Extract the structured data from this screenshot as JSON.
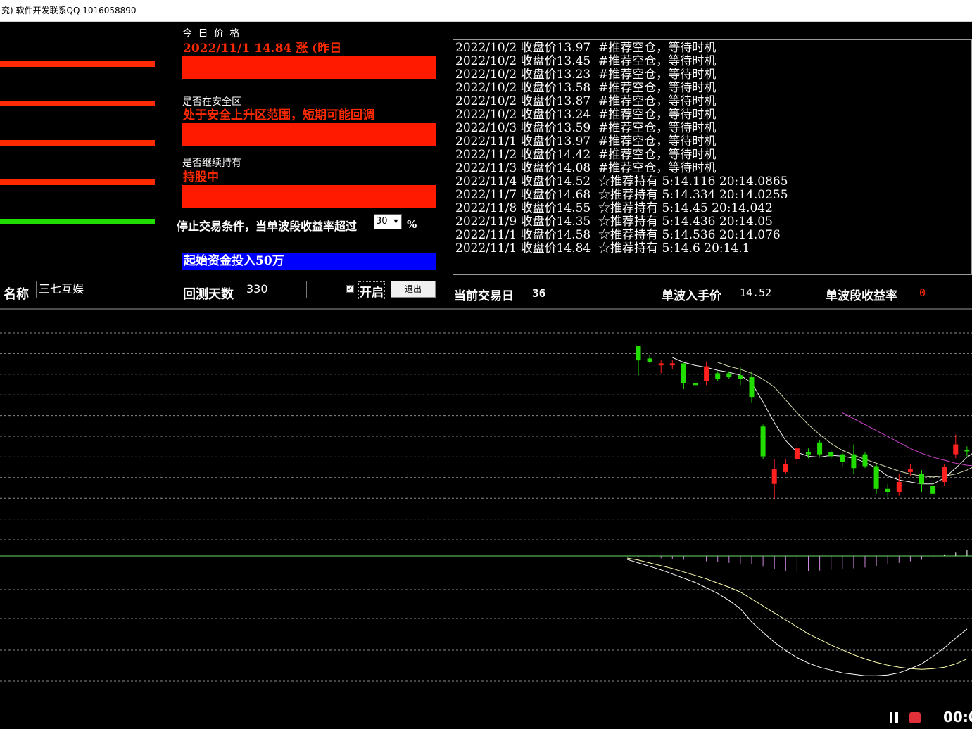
{
  "window": {
    "title": "究) 软件开发联系QQ 1016058890"
  },
  "indicators": [
    {
      "color": "#ff2a00"
    },
    {
      "color": "#ff2a00"
    },
    {
      "color": "#ff2a00"
    },
    {
      "color": "#ff2a00"
    },
    {
      "color": "#22dd00"
    }
  ],
  "today_price": {
    "label": "今 日 价 格",
    "value": "2022/11/1    14.84   涨   (昨日"
  },
  "safe_zone": {
    "label": "是否在安全区",
    "value": "处于安全上升区范围，短期可能回调"
  },
  "hold": {
    "label": "是否继续持有",
    "value": "持股中"
  },
  "stop_condition": {
    "label": "停止交易条件，当单波段收益率超过",
    "selected": "30",
    "unit": "%"
  },
  "capital": {
    "label": "起始资金投入50万"
  },
  "name_field": {
    "label": "名称",
    "value": "三七互娱"
  },
  "backtest": {
    "label": "回测天数",
    "value": "330"
  },
  "start_toggle": {
    "label": "开启",
    "checked": true
  },
  "exit_button": {
    "label": "退出"
  },
  "status": {
    "trade_day_label": "当前交易日",
    "trade_day_value": "36",
    "entry_price_label": "单波入手价",
    "entry_price_value": "14.52",
    "return_label": "单波段收益率",
    "return_value": "0"
  },
  "log": [
    "2022/10/2 收盘价13.97  #推荐空仓，等待时机",
    "2022/10/2 收盘价13.45  #推荐空仓，等待时机",
    "2022/10/2 收盘价13.23  #推荐空仓，等待时机",
    "2022/10/2 收盘价13.58  #推荐空仓，等待时机",
    "2022/10/2 收盘价13.87  #推荐空仓，等待时机",
    "2022/10/2 收盘价13.24  #推荐空仓，等待时机",
    "2022/10/3 收盘价13.59  #推荐空仓，等待时机",
    "2022/11/1 收盘价13.97  #推荐空仓，等待时机",
    "2022/11/2 收盘价14.42  #推荐空仓，等待时机",
    "2022/11/3 收盘价14.08  #推荐空仓，等待时机",
    "2022/11/4 收盘价14.52  ☆推荐持有 5:14.116 20:14.0865",
    "2022/11/7 收盘价14.68  ☆推荐持有 5:14.334 20:14.0255",
    "2022/11/8 收盘价14.55  ☆推荐持有 5:14.45 20:14.042",
    "2022/11/9 收盘价14.35  ☆推荐持有 5:14.436 20:14.05",
    "2022/11/1 收盘价14.58  ☆推荐持有 5:14.536 20:14.076",
    "2022/11/1 收盘价14.84  ☆推荐持有 5:14.6 20:14.1"
  ],
  "recorder": {
    "time": "00:0"
  },
  "colors": {
    "up": "#ff2020",
    "down": "#22dd00",
    "ma5": "#ffffff",
    "ma10": "#ffffcc",
    "ma20": "#cc44cc",
    "zero_line": "#66dd66"
  },
  "chart_data": {
    "type": "candlestick",
    "candles": [
      {
        "o": 13.1,
        "h": 13.1,
        "l": 12.8,
        "c": 12.95
      },
      {
        "o": 12.97,
        "h": 13.0,
        "l": 12.92,
        "c": 12.93
      },
      {
        "o": 12.9,
        "h": 12.95,
        "l": 12.82,
        "c": 12.92
      },
      {
        "o": 12.9,
        "h": 12.95,
        "l": 12.86,
        "c": 12.92
      },
      {
        "o": 12.92,
        "h": 12.92,
        "l": 12.66,
        "c": 12.72
      },
      {
        "o": 12.72,
        "h": 12.74,
        "l": 12.65,
        "c": 12.7
      },
      {
        "o": 12.74,
        "h": 12.94,
        "l": 12.7,
        "c": 12.89
      },
      {
        "o": 12.82,
        "h": 12.84,
        "l": 12.74,
        "c": 12.76
      },
      {
        "o": 12.82,
        "h": 12.84,
        "l": 12.76,
        "c": 12.78
      },
      {
        "o": 12.8,
        "h": 12.88,
        "l": 12.7,
        "c": 12.76
      },
      {
        "o": 12.78,
        "h": 12.84,
        "l": 12.52,
        "c": 12.58
      },
      {
        "o": 12.28,
        "h": 12.3,
        "l": 11.95,
        "c": 11.98
      },
      {
        "o": 11.7,
        "h": 11.95,
        "l": 11.55,
        "c": 11.85
      },
      {
        "o": 11.82,
        "h": 11.95,
        "l": 11.8,
        "c": 11.9
      },
      {
        "o": 11.95,
        "h": 12.12,
        "l": 11.9,
        "c": 12.06
      },
      {
        "o": 12.02,
        "h": 12.06,
        "l": 11.96,
        "c": 12.0
      },
      {
        "o": 12.12,
        "h": 12.14,
        "l": 11.98,
        "c": 12.0
      },
      {
        "o": 12.02,
        "h": 12.04,
        "l": 11.95,
        "c": 11.98
      },
      {
        "o": 12.0,
        "h": 12.02,
        "l": 11.88,
        "c": 11.92
      },
      {
        "o": 12.0,
        "h": 12.1,
        "l": 11.8,
        "c": 11.86
      },
      {
        "o": 12.0,
        "h": 12.02,
        "l": 11.86,
        "c": 11.88
      },
      {
        "o": 11.88,
        "h": 11.9,
        "l": 11.6,
        "c": 11.65
      },
      {
        "o": 11.65,
        "h": 11.7,
        "l": 11.57,
        "c": 11.62
      },
      {
        "o": 11.62,
        "h": 11.8,
        "l": 11.58,
        "c": 11.72
      },
      {
        "o": 11.82,
        "h": 11.9,
        "l": 11.78,
        "c": 11.85
      },
      {
        "o": 11.8,
        "h": 11.84,
        "l": 11.62,
        "c": 11.7
      },
      {
        "o": 11.68,
        "h": 11.74,
        "l": 11.58,
        "c": 11.6
      },
      {
        "o": 11.72,
        "h": 11.9,
        "l": 11.68,
        "c": 11.87
      },
      {
        "o": 12.0,
        "h": 12.2,
        "l": 11.96,
        "c": 12.1
      },
      {
        "o": 12.04,
        "h": 12.08,
        "l": 11.98,
        "c": 12.03
      },
      {
        "o": 12.0,
        "h": 12.26,
        "l": 11.98,
        "c": 12.14
      }
    ],
    "ma5": [
      null,
      null,
      null,
      12.98,
      12.93,
      12.9,
      12.88,
      12.85,
      12.83,
      12.8,
      12.72,
      12.53,
      12.32,
      12.14,
      12.02,
      11.98,
      11.97,
      11.99,
      11.98,
      11.96,
      11.92,
      11.86,
      11.78,
      11.74,
      11.72,
      11.7,
      11.7,
      11.76,
      11.86,
      11.97,
      12.05
    ],
    "ma10": [
      null,
      null,
      null,
      null,
      null,
      null,
      null,
      12.93,
      12.89,
      12.86,
      12.82,
      12.76,
      12.68,
      12.55,
      12.42,
      12.3,
      12.2,
      12.11,
      12.04,
      11.99,
      11.95,
      11.91,
      11.87,
      11.83,
      11.8,
      11.78,
      11.77,
      11.78,
      11.8,
      11.84,
      11.9
    ],
    "ma20": [
      null,
      null,
      null,
      null,
      null,
      null,
      null,
      null,
      null,
      null,
      null,
      null,
      null,
      null,
      null,
      null,
      null,
      null,
      12.42,
      12.36,
      12.3,
      12.24,
      12.18,
      12.12,
      12.06,
      12.01,
      11.97,
      11.94,
      11.91,
      11.89,
      11.88
    ],
    "macd_hist": [
      -0.02,
      -0.04,
      -0.06,
      -0.08,
      -0.1,
      -0.12,
      -0.14,
      -0.16,
      -0.18,
      -0.2,
      -0.22,
      -0.28,
      -0.34,
      -0.4,
      -0.42,
      -0.4,
      -0.38,
      -0.36,
      -0.34,
      -0.32,
      -0.3,
      -0.26,
      -0.22,
      -0.18,
      -0.14,
      -0.1,
      -0.06,
      0.02,
      0.08,
      0.14,
      0.2
    ],
    "dif": [
      -0.05,
      -0.1,
      -0.15,
      -0.2,
      -0.26,
      -0.32,
      -0.38,
      -0.46,
      -0.54,
      -0.64,
      -0.76,
      -0.95,
      -1.1,
      -1.24,
      -1.36,
      -1.46,
      -1.54,
      -1.6,
      -1.64,
      -1.68,
      -1.7,
      -1.72,
      -1.72,
      -1.71,
      -1.68,
      -1.62,
      -1.55,
      -1.44,
      -1.32,
      -1.18,
      -1.05
    ],
    "dea": [
      -0.03,
      -0.06,
      -0.1,
      -0.14,
      -0.18,
      -0.23,
      -0.28,
      -0.33,
      -0.39,
      -0.45,
      -0.52,
      -0.62,
      -0.72,
      -0.82,
      -0.92,
      -1.02,
      -1.12,
      -1.2,
      -1.28,
      -1.35,
      -1.42,
      -1.48,
      -1.53,
      -1.57,
      -1.6,
      -1.62,
      -1.63,
      -1.62,
      -1.6,
      -1.55,
      -1.48
    ],
    "price_range": [
      11.2,
      13.3
    ],
    "macd_range": [
      -1.9,
      0.25
    ]
  }
}
